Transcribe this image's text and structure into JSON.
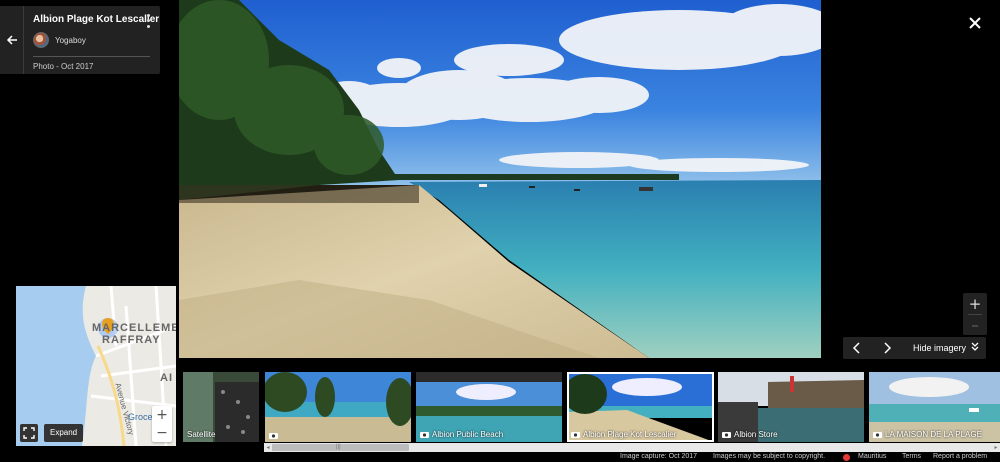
{
  "info_card": {
    "title": "Albion Plage Kot Lescalier",
    "author": "Yogaboy",
    "date": "Photo - Oct 2017"
  },
  "controls": {
    "zoom_in": "+",
    "zoom_out": "–",
    "hide_imagery": "Hide imagery"
  },
  "minimap": {
    "labels": [
      "MARCELLEMENT",
      "RAFFRAY",
      "AI"
    ],
    "streets": [
      "Avenue Victory"
    ],
    "poi": "Groce",
    "zoom_in": "+",
    "zoom_out": "−",
    "expand_tooltip": "Expand"
  },
  "filmstrip": [
    {
      "caption": "Satellite"
    },
    {
      "caption": ""
    },
    {
      "caption": "Albion Public Beach"
    },
    {
      "caption": "Albion Plage Kot Lescalier",
      "selected": true
    },
    {
      "caption": "Albion Store"
    },
    {
      "caption": "LA MAISON DE LA PLAGE"
    }
  ],
  "footer": {
    "capture": "Image capture: Oct 2017",
    "copyright": "Images may be subject to copyright.",
    "region": "Mauritius",
    "terms": "Terms",
    "report": "Report a problem"
  },
  "colors": {
    "sky": "#2a6fd6",
    "sea": "#3aa3b8",
    "sand": "#d8c8a0",
    "panel": "#222222"
  }
}
